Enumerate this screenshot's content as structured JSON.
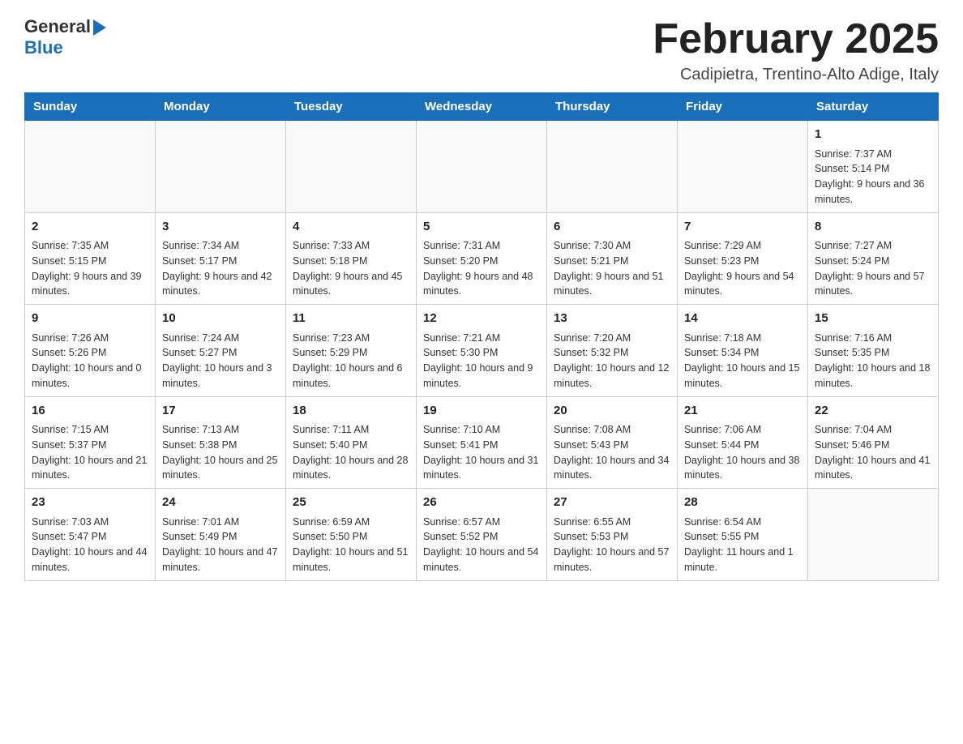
{
  "header": {
    "logo_general": "General",
    "logo_blue": "Blue",
    "month_year": "February 2025",
    "location": "Cadipietra, Trentino-Alto Adige, Italy"
  },
  "days_of_week": [
    "Sunday",
    "Monday",
    "Tuesday",
    "Wednesday",
    "Thursday",
    "Friday",
    "Saturday"
  ],
  "weeks": [
    {
      "days": [
        {
          "num": "",
          "info": ""
        },
        {
          "num": "",
          "info": ""
        },
        {
          "num": "",
          "info": ""
        },
        {
          "num": "",
          "info": ""
        },
        {
          "num": "",
          "info": ""
        },
        {
          "num": "",
          "info": ""
        },
        {
          "num": "1",
          "info": "Sunrise: 7:37 AM\nSunset: 5:14 PM\nDaylight: 9 hours and 36 minutes."
        }
      ]
    },
    {
      "days": [
        {
          "num": "2",
          "info": "Sunrise: 7:35 AM\nSunset: 5:15 PM\nDaylight: 9 hours and 39 minutes."
        },
        {
          "num": "3",
          "info": "Sunrise: 7:34 AM\nSunset: 5:17 PM\nDaylight: 9 hours and 42 minutes."
        },
        {
          "num": "4",
          "info": "Sunrise: 7:33 AM\nSunset: 5:18 PM\nDaylight: 9 hours and 45 minutes."
        },
        {
          "num": "5",
          "info": "Sunrise: 7:31 AM\nSunset: 5:20 PM\nDaylight: 9 hours and 48 minutes."
        },
        {
          "num": "6",
          "info": "Sunrise: 7:30 AM\nSunset: 5:21 PM\nDaylight: 9 hours and 51 minutes."
        },
        {
          "num": "7",
          "info": "Sunrise: 7:29 AM\nSunset: 5:23 PM\nDaylight: 9 hours and 54 minutes."
        },
        {
          "num": "8",
          "info": "Sunrise: 7:27 AM\nSunset: 5:24 PM\nDaylight: 9 hours and 57 minutes."
        }
      ]
    },
    {
      "days": [
        {
          "num": "9",
          "info": "Sunrise: 7:26 AM\nSunset: 5:26 PM\nDaylight: 10 hours and 0 minutes."
        },
        {
          "num": "10",
          "info": "Sunrise: 7:24 AM\nSunset: 5:27 PM\nDaylight: 10 hours and 3 minutes."
        },
        {
          "num": "11",
          "info": "Sunrise: 7:23 AM\nSunset: 5:29 PM\nDaylight: 10 hours and 6 minutes."
        },
        {
          "num": "12",
          "info": "Sunrise: 7:21 AM\nSunset: 5:30 PM\nDaylight: 10 hours and 9 minutes."
        },
        {
          "num": "13",
          "info": "Sunrise: 7:20 AM\nSunset: 5:32 PM\nDaylight: 10 hours and 12 minutes."
        },
        {
          "num": "14",
          "info": "Sunrise: 7:18 AM\nSunset: 5:34 PM\nDaylight: 10 hours and 15 minutes."
        },
        {
          "num": "15",
          "info": "Sunrise: 7:16 AM\nSunset: 5:35 PM\nDaylight: 10 hours and 18 minutes."
        }
      ]
    },
    {
      "days": [
        {
          "num": "16",
          "info": "Sunrise: 7:15 AM\nSunset: 5:37 PM\nDaylight: 10 hours and 21 minutes."
        },
        {
          "num": "17",
          "info": "Sunrise: 7:13 AM\nSunset: 5:38 PM\nDaylight: 10 hours and 25 minutes."
        },
        {
          "num": "18",
          "info": "Sunrise: 7:11 AM\nSunset: 5:40 PM\nDaylight: 10 hours and 28 minutes."
        },
        {
          "num": "19",
          "info": "Sunrise: 7:10 AM\nSunset: 5:41 PM\nDaylight: 10 hours and 31 minutes."
        },
        {
          "num": "20",
          "info": "Sunrise: 7:08 AM\nSunset: 5:43 PM\nDaylight: 10 hours and 34 minutes."
        },
        {
          "num": "21",
          "info": "Sunrise: 7:06 AM\nSunset: 5:44 PM\nDaylight: 10 hours and 38 minutes."
        },
        {
          "num": "22",
          "info": "Sunrise: 7:04 AM\nSunset: 5:46 PM\nDaylight: 10 hours and 41 minutes."
        }
      ]
    },
    {
      "days": [
        {
          "num": "23",
          "info": "Sunrise: 7:03 AM\nSunset: 5:47 PM\nDaylight: 10 hours and 44 minutes."
        },
        {
          "num": "24",
          "info": "Sunrise: 7:01 AM\nSunset: 5:49 PM\nDaylight: 10 hours and 47 minutes."
        },
        {
          "num": "25",
          "info": "Sunrise: 6:59 AM\nSunset: 5:50 PM\nDaylight: 10 hours and 51 minutes."
        },
        {
          "num": "26",
          "info": "Sunrise: 6:57 AM\nSunset: 5:52 PM\nDaylight: 10 hours and 54 minutes."
        },
        {
          "num": "27",
          "info": "Sunrise: 6:55 AM\nSunset: 5:53 PM\nDaylight: 10 hours and 57 minutes."
        },
        {
          "num": "28",
          "info": "Sunrise: 6:54 AM\nSunset: 5:55 PM\nDaylight: 11 hours and 1 minute."
        },
        {
          "num": "",
          "info": ""
        }
      ]
    }
  ]
}
